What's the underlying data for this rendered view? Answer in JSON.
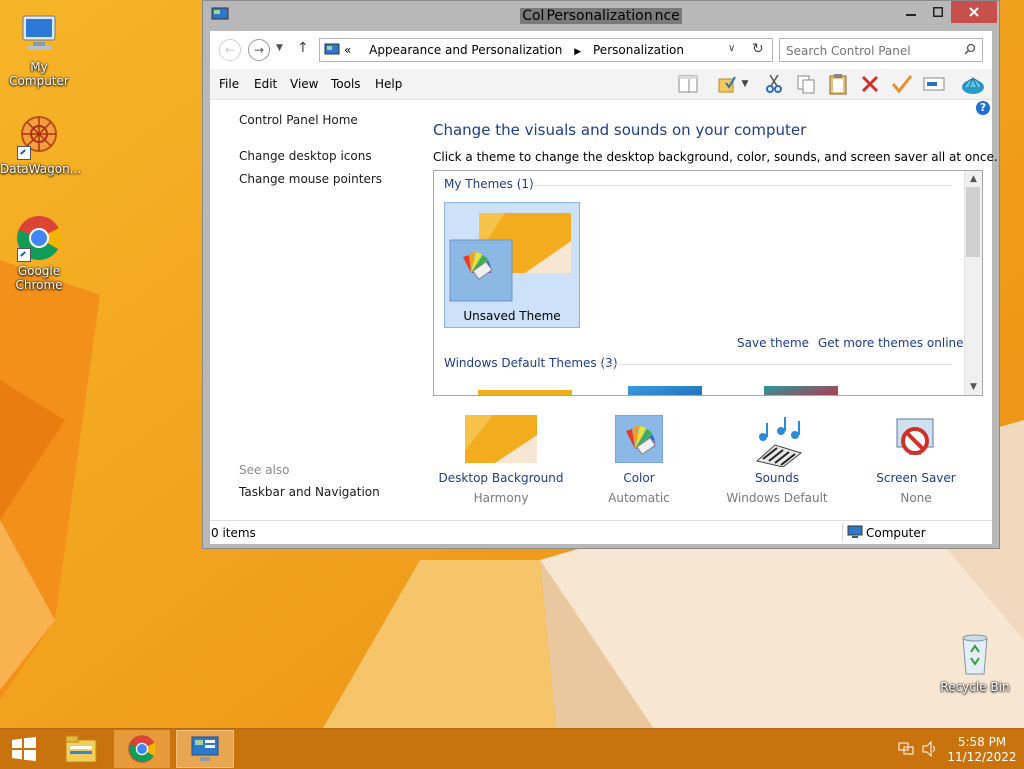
{
  "desktop": {
    "icons": [
      {
        "label": "My Computer"
      },
      {
        "label": "DataWagon..."
      },
      {
        "label": "Google Chrome"
      },
      {
        "label": "Recycle Bin"
      }
    ]
  },
  "window": {
    "title_pre": "Col",
    "title_main": "Personalization",
    "title_post": "nce",
    "address": {
      "prefix": "«",
      "crumbs": [
        "Appearance and Personalization",
        "Personalization"
      ]
    },
    "search": {
      "placeholder": "Search Control Panel"
    },
    "menu": [
      "File",
      "Edit",
      "View",
      "Tools",
      "Help"
    ],
    "left_pane": {
      "home": "Control Panel Home",
      "links": [
        "Change desktop icons",
        "Change mouse pointers"
      ],
      "see_also_label": "See also",
      "see_also_links": [
        "Taskbar and Navigation"
      ]
    },
    "main": {
      "heading": "Change the visuals and sounds on your computer",
      "description": "Click a theme to change the desktop background, color, sounds, and screen saver all at once.",
      "my_themes_label": "My Themes (1)",
      "current_theme": "Unsaved Theme",
      "save_theme": "Save theme",
      "get_more": "Get more themes online",
      "default_themes_label": "Windows Default Themes (3)"
    },
    "settings": [
      {
        "name": "Desktop Background",
        "value": "Harmony"
      },
      {
        "name": "Color",
        "value": "Automatic"
      },
      {
        "name": "Sounds",
        "value": "Windows Default"
      },
      {
        "name": "Screen Saver",
        "value": "None"
      }
    ],
    "status": {
      "items": "0 items",
      "location": "Computer"
    }
  },
  "taskbar": {
    "time": "5:58 PM",
    "date": "11/12/2022"
  },
  "colors": {
    "link": "#1e3d8a",
    "accent": "#f5a316",
    "close": "#c7504c"
  }
}
